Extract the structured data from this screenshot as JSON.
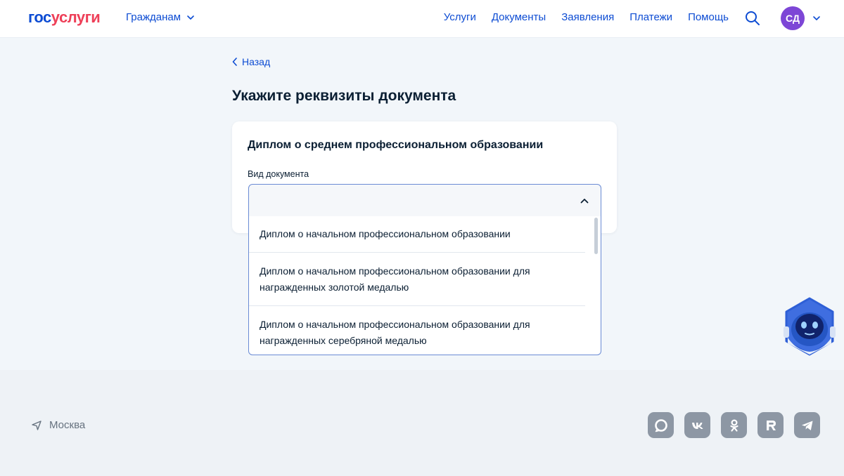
{
  "header": {
    "logo_part1": "гос",
    "logo_part2": "услуги",
    "audience_label": "Гражданам",
    "nav": [
      "Услуги",
      "Документы",
      "Заявления",
      "Платежи",
      "Помощь"
    ],
    "avatar_initials": "СД"
  },
  "main": {
    "back_label": "Назад",
    "page_title": "Укажите реквизиты документа",
    "card_title": "Диплом о среднем профессиональном образовании",
    "field_label": "Вид документа",
    "select_value": "",
    "options": [
      "Диплом о начальном профессиональном образовании",
      "Диплом о начальном профессиональном образовании для награжденных золотой медалью",
      "Диплом о начальном профессиональном образовании для награжденных серебряной медалью"
    ]
  },
  "footer": {
    "city": "Москва",
    "socials": [
      "max-icon",
      "vk-icon",
      "ok-icon",
      "rutube-icon",
      "telegram-icon"
    ]
  },
  "colors": {
    "brand_blue": "#0d4cd3",
    "brand_red": "#ee3f58",
    "avatar_purple": "#7d46d6",
    "social_gray": "#8d97a4"
  }
}
